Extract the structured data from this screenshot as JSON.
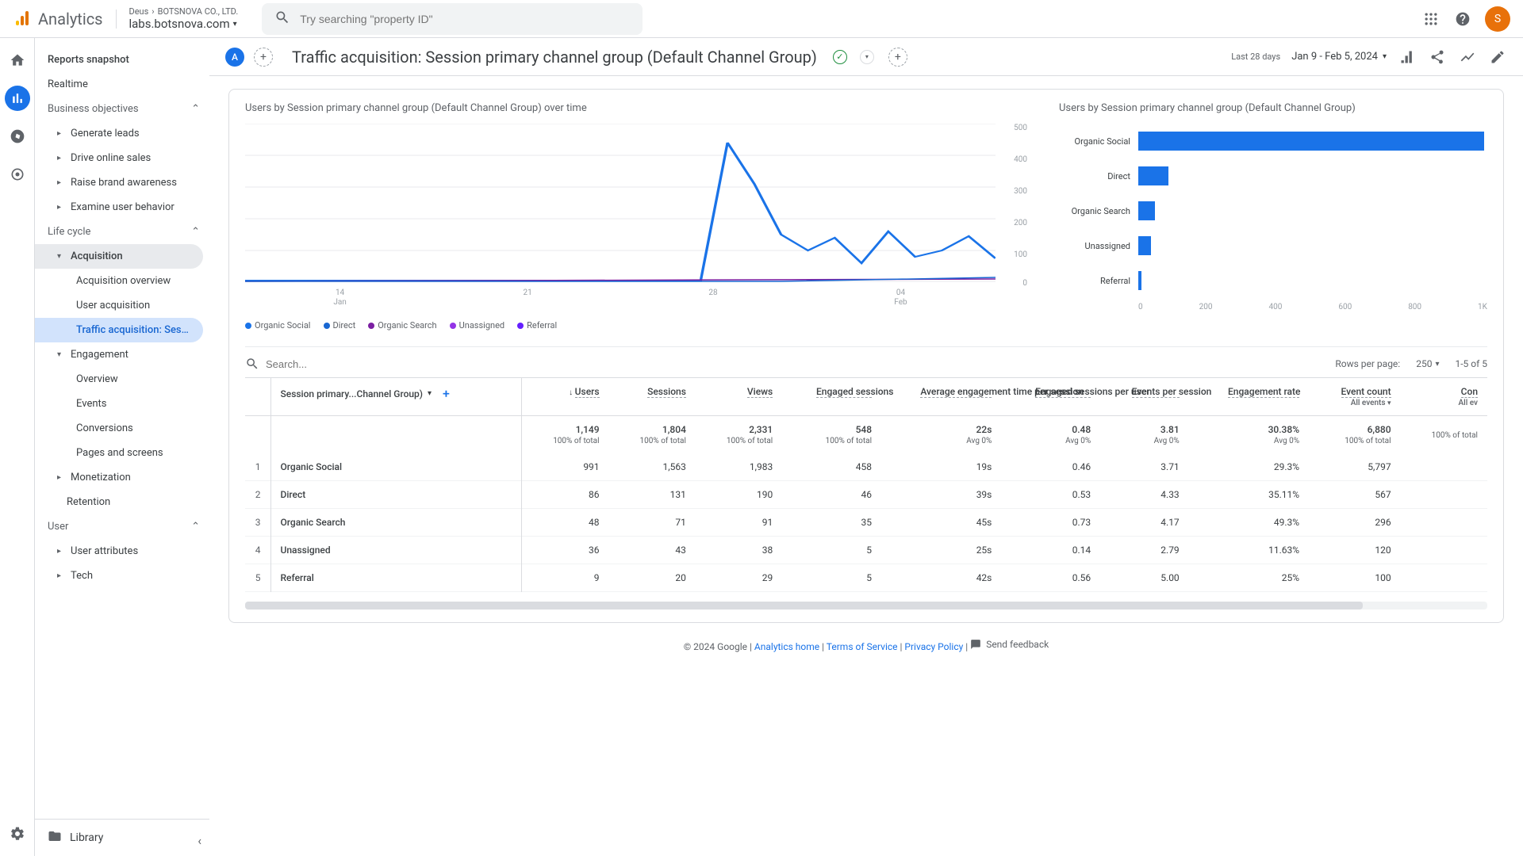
{
  "header": {
    "product": "Analytics",
    "breadcrumb_parent": "Deus",
    "breadcrumb_company": "BOTSNOVA CO., LTD.",
    "breadcrumb_property": "labs.botsnova.com",
    "search_placeholder": "Try searching \"property ID\"",
    "avatar_initial": "S"
  },
  "sidebar": {
    "reports_snapshot": "Reports snapshot",
    "realtime": "Realtime",
    "section_biz": "Business objectives",
    "generate_leads": "Generate leads",
    "drive_sales": "Drive online sales",
    "raise_brand": "Raise brand awareness",
    "examine_user": "Examine user behavior",
    "section_life": "Life cycle",
    "acquisition": "Acquisition",
    "acq_overview": "Acquisition overview",
    "user_acq": "User acquisition",
    "traffic_acq": "Traffic acquisition: Session...",
    "engagement": "Engagement",
    "eng_overview": "Overview",
    "events": "Events",
    "conversions": "Conversions",
    "pages_screens": "Pages and screens",
    "monetization": "Monetization",
    "retention": "Retention",
    "section_user": "User",
    "user_attrs": "User attributes",
    "tech": "Tech",
    "library": "Library"
  },
  "titlebar": {
    "chip": "A",
    "title": "Traffic acquisition: Session primary channel group (Default Channel Group)",
    "date_label": "Last 28 days",
    "date_range": "Jan 9 - Feb 5, 2024"
  },
  "charts": {
    "line_title": "Users by Session primary channel group (Default Channel Group) over time",
    "bar_title": "Users by Session primary channel group (Default Channel Group)",
    "legend": [
      "Organic Social",
      "Direct",
      "Organic Search",
      "Unassigned",
      "Referral"
    ],
    "legend_colors": [
      "#1a73e8",
      "#1967d2",
      "#7b1fa2",
      "#9334e6",
      "#651fff"
    ],
    "y_ticks": [
      "500",
      "400",
      "300",
      "200",
      "100",
      "0"
    ],
    "x_ticks": [
      {
        "d": "14",
        "m": "Jan"
      },
      {
        "d": "21",
        "m": ""
      },
      {
        "d": "28",
        "m": ""
      },
      {
        "d": "04",
        "m": "Feb"
      }
    ],
    "bar_x": [
      "0",
      "200",
      "400",
      "600",
      "800",
      "1K"
    ]
  },
  "chart_data": {
    "line": {
      "type": "line",
      "title": "Users by Session primary channel group (Default Channel Group) over time",
      "xlabel": "",
      "ylabel": "Users",
      "ylim": [
        0,
        500
      ],
      "x": [
        "09 Jan",
        "10 Jan",
        "11 Jan",
        "12 Jan",
        "13 Jan",
        "14 Jan",
        "15 Jan",
        "16 Jan",
        "17 Jan",
        "18 Jan",
        "19 Jan",
        "20 Jan",
        "21 Jan",
        "22 Jan",
        "23 Jan",
        "24 Jan",
        "25 Jan",
        "26 Jan",
        "27 Jan",
        "28 Jan",
        "29 Jan",
        "30 Jan",
        "31 Jan",
        "01 Feb",
        "02 Feb",
        "03 Feb",
        "04 Feb",
        "05 Feb"
      ],
      "series": [
        {
          "name": "Organic Social",
          "values": [
            5,
            5,
            5,
            5,
            5,
            5,
            5,
            5,
            5,
            5,
            5,
            5,
            5,
            5,
            5,
            5,
            5,
            440,
            310,
            150,
            100,
            140,
            60,
            160,
            80,
            100,
            145,
            75
          ]
        },
        {
          "name": "Direct",
          "values": [
            2,
            2,
            2,
            2,
            2,
            2,
            2,
            2,
            2,
            2,
            2,
            2,
            2,
            2,
            2,
            2,
            2,
            2,
            5,
            4,
            5,
            6,
            5,
            7,
            6,
            8,
            10,
            15
          ]
        },
        {
          "name": "Organic Search",
          "values": [
            2,
            2,
            2,
            2,
            2,
            2,
            2,
            2,
            2,
            2,
            2,
            2,
            2,
            2,
            2,
            2,
            2,
            2,
            2,
            3,
            3,
            3,
            4,
            4,
            5,
            5,
            6,
            6
          ]
        },
        {
          "name": "Unassigned",
          "values": [
            1,
            1,
            1,
            1,
            1,
            1,
            1,
            1,
            1,
            1,
            1,
            1,
            1,
            1,
            1,
            1,
            1,
            1,
            1,
            1,
            1,
            1,
            1,
            1,
            2,
            2,
            2,
            2
          ]
        },
        {
          "name": "Referral",
          "values": [
            0,
            0,
            0,
            0,
            0,
            0,
            0,
            0,
            0,
            0,
            0,
            0,
            0,
            0,
            0,
            0,
            0,
            0,
            0,
            0,
            0,
            0,
            0,
            0,
            1,
            1,
            1,
            1
          ]
        }
      ]
    },
    "bar": {
      "type": "bar",
      "title": "Users by Session primary channel group (Default Channel Group)",
      "categories": [
        "Organic Social",
        "Direct",
        "Organic Search",
        "Unassigned",
        "Referral"
      ],
      "values": [
        991,
        86,
        48,
        36,
        9
      ],
      "xlim": [
        0,
        1000
      ]
    }
  },
  "table": {
    "search_placeholder": "Search...",
    "rows_per_page_label": "Rows per page:",
    "rows_per_page": "250",
    "page_info": "1-5 of 5",
    "dim_header": "Session primary...Channel Group)",
    "cols": [
      "Users",
      "Sessions",
      "Views",
      "Engaged sessions",
      "Average engagement time per session",
      "Engaged sessions per user",
      "Events per session",
      "Engagement rate",
      "Event count"
    ],
    "event_count_sub": "All events",
    "conv_header": "Con",
    "conv_sub": "All ev",
    "totals": {
      "users": "1,149",
      "sessions": "1,804",
      "views": "2,331",
      "engaged": "548",
      "avg_time": "22s",
      "eng_per_user": "0.48",
      "events_per_session": "3.81",
      "eng_rate": "30.38%",
      "event_count": "6,880",
      "sub_pct": "100% of total",
      "sub_avg": "Avg 0%"
    },
    "rows": [
      {
        "n": "1",
        "ch": "Organic Social",
        "v": [
          "991",
          "1,563",
          "1,983",
          "458",
          "19s",
          "0.46",
          "3.71",
          "29.3%",
          "5,797"
        ]
      },
      {
        "n": "2",
        "ch": "Direct",
        "v": [
          "86",
          "131",
          "190",
          "46",
          "39s",
          "0.53",
          "4.33",
          "35.11%",
          "567"
        ]
      },
      {
        "n": "3",
        "ch": "Organic Search",
        "v": [
          "48",
          "71",
          "91",
          "35",
          "45s",
          "0.73",
          "4.17",
          "49.3%",
          "296"
        ]
      },
      {
        "n": "4",
        "ch": "Unassigned",
        "v": [
          "36",
          "43",
          "38",
          "5",
          "25s",
          "0.14",
          "2.79",
          "11.63%",
          "120"
        ]
      },
      {
        "n": "5",
        "ch": "Referral",
        "v": [
          "9",
          "20",
          "29",
          "5",
          "42s",
          "0.56",
          "5.00",
          "25%",
          "100"
        ]
      }
    ]
  },
  "footer": {
    "copyright": "© 2024 Google",
    "analytics_home": "Analytics home",
    "terms": "Terms of Service",
    "privacy": "Privacy Policy",
    "feedback": "Send feedback"
  }
}
